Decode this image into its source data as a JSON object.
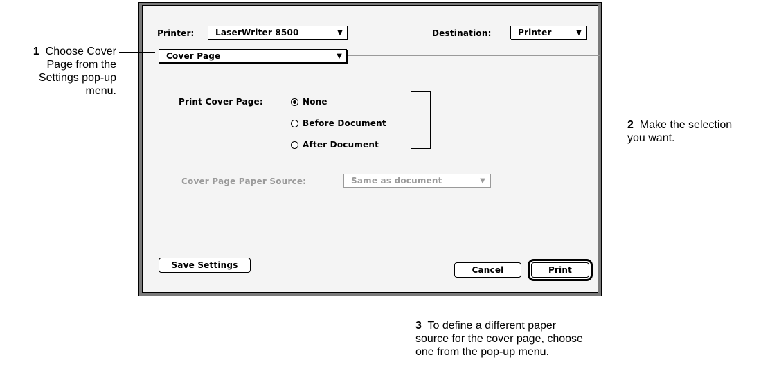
{
  "dialog": {
    "printer_label": "Printer:",
    "printer_value": "LaserWriter 8500",
    "destination_label": "Destination:",
    "destination_value": "Printer",
    "settings_value": "Cover Page",
    "print_cover_label": "Print Cover Page:",
    "options": [
      "None",
      "Before Document",
      "After Document"
    ],
    "selected_option": "None",
    "paper_source_label": "Cover Page Paper Source:",
    "paper_source_value": "Same as document",
    "save_settings": "Save Settings",
    "cancel": "Cancel",
    "print": "Print"
  },
  "callouts": {
    "c1": {
      "num": "1",
      "lines": [
        "Choose Cover",
        "Page from the",
        "Settings pop-up",
        "menu."
      ]
    },
    "c2": {
      "num": "2",
      "lines": [
        "Make the selection",
        "you want."
      ]
    },
    "c3": {
      "num": "3",
      "lines": [
        "To define a different paper",
        "source for the cover page, choose",
        "one from the pop-up menu."
      ]
    }
  }
}
